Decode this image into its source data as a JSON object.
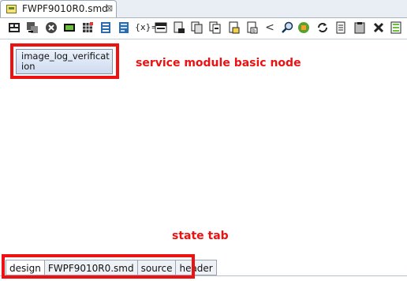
{
  "editor": {
    "tab_title": "FWPF9010R0.smd"
  },
  "toolbar": {
    "buttons": [
      "toolbar-icon-1",
      "toolbar-icon-2",
      "toolbar-icon-3",
      "toolbar-icon-4",
      "toolbar-icon-5",
      "toolbar-icon-6",
      "toolbar-icon-7",
      "toolbar-icon-8",
      "toolbar-icon-9",
      "toolbar-icon-10",
      "toolbar-icon-11",
      "toolbar-icon-12",
      "toolbar-icon-13",
      "toolbar-icon-14",
      "toolbar-icon-15",
      "toolbar-icon-16",
      "toolbar-icon-17",
      "toolbar-icon-18",
      "toolbar-icon-19",
      "toolbar-icon-20",
      "toolbar-icon-21",
      "toolbar-icon-22",
      "toolbar-icon-23",
      "toolbar-icon-24"
    ],
    "expr_label": "{x}=",
    "back_label": "<"
  },
  "canvas": {
    "node_label": "image_log_verification"
  },
  "annotations": {
    "node_note": "service module basic node",
    "tabs_note": "state tab"
  },
  "bottom_tabs": [
    {
      "label": "design",
      "active": true
    },
    {
      "label": "FWPF9010R0.smd",
      "active": false
    },
    {
      "label": "source",
      "active": false
    },
    {
      "label": "header",
      "active": false
    }
  ],
  "colors": {
    "highlight": "#ee1111",
    "node_border": "#7d90ad"
  }
}
